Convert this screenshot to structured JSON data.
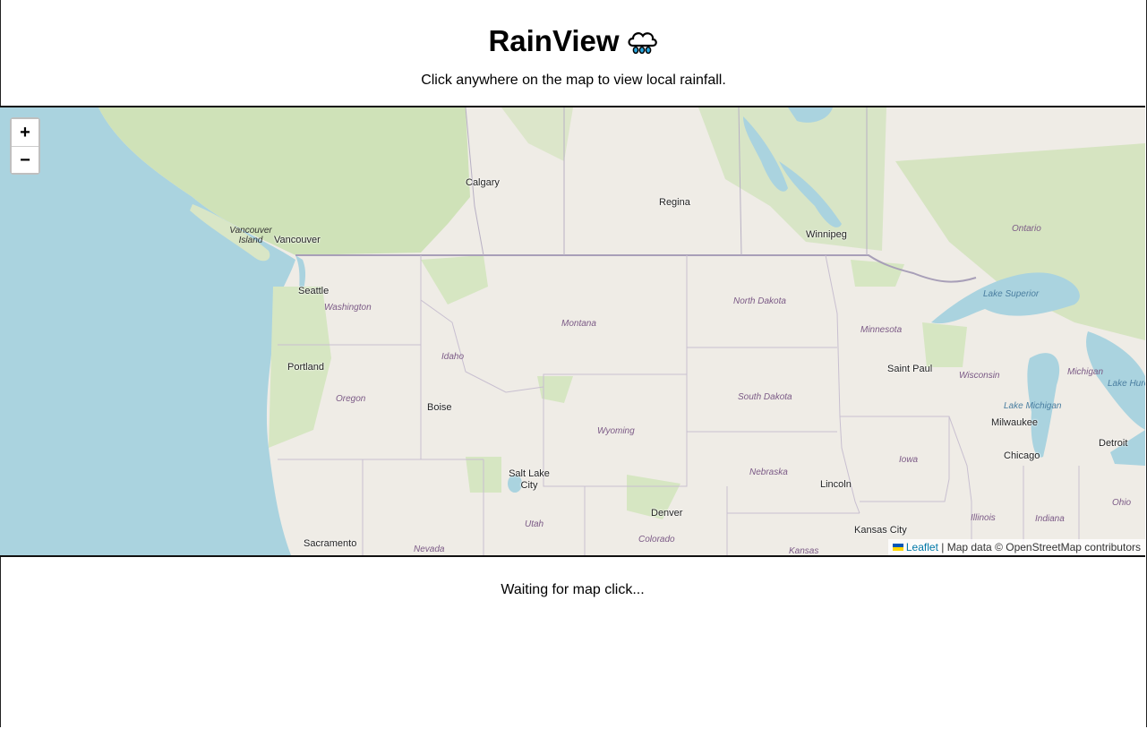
{
  "app": {
    "title": "RainView",
    "subtitle": "Click anywhere on the map to view local rainfall."
  },
  "map": {
    "zoom_in_label": "+",
    "zoom_out_label": "−",
    "cities": [
      "Calgary",
      "Regina",
      "Winnipeg",
      "Vancouver",
      "Seattle",
      "Portland",
      "Boise",
      "Saint Paul",
      "Milwaukee",
      "Chicago",
      "Detroit",
      "Salt Lake City",
      "Denver",
      "Lincoln",
      "Kansas City",
      "Sacramento"
    ],
    "regions": [
      "Vancouver Island",
      "Washington",
      "Oregon",
      "Idaho",
      "Montana",
      "Wyoming",
      "North Dakota",
      "South Dakota",
      "Nebraska",
      "Minnesota",
      "Iowa",
      "Wisconsin",
      "Michigan",
      "Illinois",
      "Indiana",
      "Ohio",
      "Utah",
      "Nevada",
      "Colorado",
      "Kansas",
      "Ontario",
      "Lake Superior",
      "Lake Michigan",
      "Lake Huro"
    ],
    "attribution": {
      "link": "Leaflet",
      "text": "| Map data © OpenStreetMap contributors"
    },
    "colors": {
      "water": "#aad3df",
      "land": "#efece6",
      "forest": "#cfe2b8",
      "border": "#a89fb8",
      "link": "#0078A8"
    }
  },
  "status": {
    "message": "Waiting for map click..."
  }
}
